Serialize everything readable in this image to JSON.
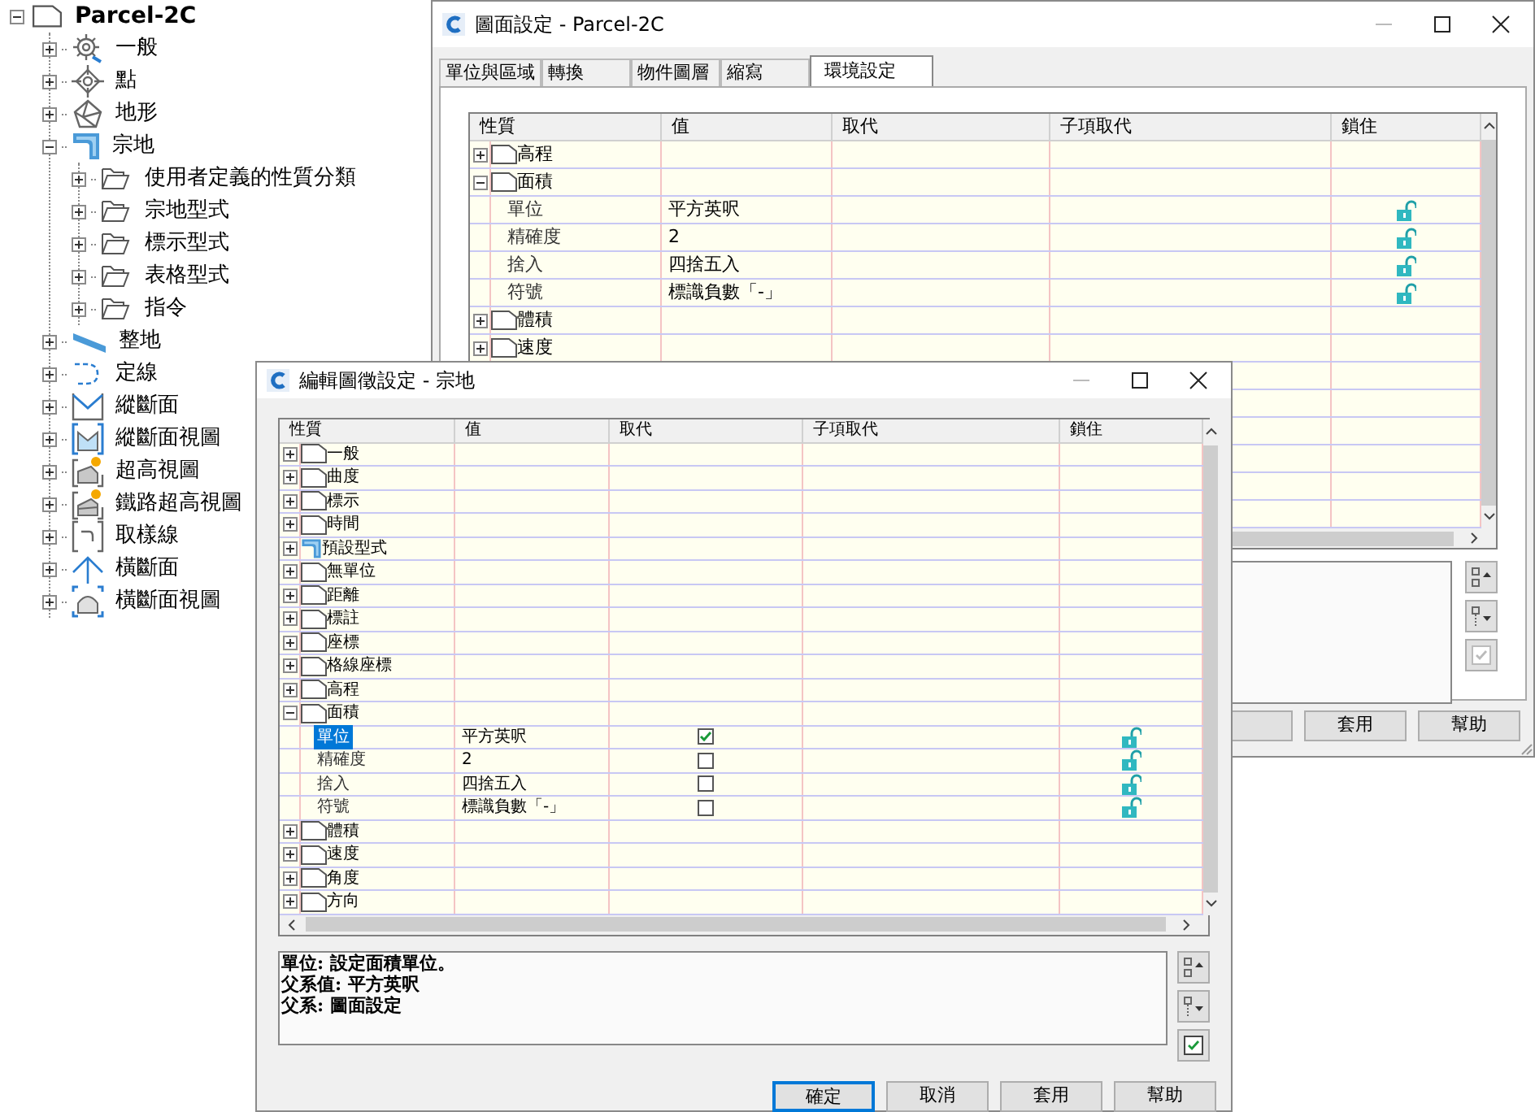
{
  "tree": {
    "label": "Parcel-2C",
    "expanded": true,
    "children": [
      {
        "label": "一般",
        "expanded": false
      },
      {
        "label": "點",
        "expanded": false
      },
      {
        "label": "地形",
        "expanded": false
      },
      {
        "label": "宗地",
        "expanded": true,
        "children": [
          {
            "label": "使用者定義的性質分類",
            "expanded": false
          },
          {
            "label": "宗地型式",
            "expanded": false
          },
          {
            "label": "標示型式",
            "expanded": false
          },
          {
            "label": "表格型式",
            "expanded": false
          },
          {
            "label": "指令",
            "expanded": false
          }
        ]
      },
      {
        "label": "整地",
        "expanded": false
      },
      {
        "label": "定線",
        "expanded": false
      },
      {
        "label": "縱斷面",
        "expanded": false
      },
      {
        "label": "縱斷面視圖",
        "expanded": false
      },
      {
        "label": "超高視圖",
        "expanded": false
      },
      {
        "label": "鐵路超高視圖",
        "expanded": false
      },
      {
        "label": "取樣線",
        "expanded": false
      },
      {
        "label": "橫斷面",
        "expanded": false
      },
      {
        "label": "橫斷面視圖",
        "expanded": false
      }
    ]
  },
  "back_dialog": {
    "title": "圖面設定 - Parcel-2C",
    "tabs": [
      {
        "label": "單位與區域",
        "selected": false
      },
      {
        "label": "轉換",
        "selected": false
      },
      {
        "label": "物件圖層",
        "selected": false
      },
      {
        "label": "縮寫",
        "selected": false
      },
      {
        "label": "環境設定",
        "selected": true
      }
    ],
    "grid": {
      "columns": [
        "性質",
        "值",
        "取代",
        "子項取代",
        "鎖住"
      ],
      "rows": [
        {
          "kind": "group",
          "label": "高程",
          "expanded": false
        },
        {
          "kind": "group",
          "label": "面積",
          "expanded": true,
          "children": [
            {
              "kind": "property",
              "label": "單位",
              "value": "平方英呎",
              "locked": false,
              "selected": false
            },
            {
              "kind": "property",
              "label": "精確度",
              "value": "2",
              "locked": false,
              "selected": false
            },
            {
              "kind": "property",
              "label": "捨入",
              "value": "四捨五入",
              "locked": false,
              "selected": false
            },
            {
              "kind": "property",
              "label": "符號",
              "value": "標識負數「-」",
              "locked": false,
              "selected": false
            }
          ]
        },
        {
          "kind": "group",
          "label": "體積",
          "expanded": false
        },
        {
          "kind": "group",
          "label": "速度",
          "expanded": false
        }
      ]
    },
    "buttons": [
      {
        "label": "套用",
        "default": false
      },
      {
        "label": "幫助",
        "default": false
      }
    ]
  },
  "front_dialog": {
    "title": "編輯圖徵設定 - 宗地",
    "grid": {
      "columns": [
        "性質",
        "值",
        "取代",
        "子項取代",
        "鎖住"
      ],
      "rows": [
        {
          "kind": "group",
          "label": "一般",
          "expanded": false
        },
        {
          "kind": "group",
          "label": "曲度",
          "expanded": false
        },
        {
          "kind": "group",
          "label": "標示",
          "expanded": false
        },
        {
          "kind": "group",
          "label": "時間",
          "expanded": false
        },
        {
          "kind": "style",
          "label": "預設型式",
          "expanded": false
        },
        {
          "kind": "group",
          "label": "無單位",
          "expanded": false
        },
        {
          "kind": "group",
          "label": "距離",
          "expanded": false
        },
        {
          "kind": "group",
          "label": "標註",
          "expanded": false
        },
        {
          "kind": "group",
          "label": "座標",
          "expanded": false
        },
        {
          "kind": "group",
          "label": "格線座標",
          "expanded": false
        },
        {
          "kind": "group",
          "label": "高程",
          "expanded": false
        },
        {
          "kind": "group",
          "label": "面積",
          "expanded": true,
          "children": [
            {
              "kind": "property",
              "label": "單位",
              "value": "平方英呎",
              "override": true,
              "locked": false,
              "selected": true
            },
            {
              "kind": "property",
              "label": "精確度",
              "value": "2",
              "override": false,
              "locked": false,
              "selected": false
            },
            {
              "kind": "property",
              "label": "捨入",
              "value": "四捨五入",
              "override": false,
              "locked": false,
              "selected": false
            },
            {
              "kind": "property",
              "label": "符號",
              "value": "標識負數「-」",
              "override": false,
              "locked": false,
              "selected": false
            }
          ]
        },
        {
          "kind": "group",
          "label": "體積",
          "expanded": false
        },
        {
          "kind": "group",
          "label": "速度",
          "expanded": false
        },
        {
          "kind": "group",
          "label": "角度",
          "expanded": false
        },
        {
          "kind": "group",
          "label": "方向",
          "expanded": false
        }
      ]
    },
    "description": [
      "單位: 設定面積單位。",
      "父系值: 平方英呎",
      "父系: 圖面設定"
    ],
    "buttons": [
      {
        "label": "確定",
        "default": true
      },
      {
        "label": "取消",
        "default": false
      },
      {
        "label": "套用",
        "default": false
      },
      {
        "label": "幫助",
        "default": false
      }
    ]
  }
}
